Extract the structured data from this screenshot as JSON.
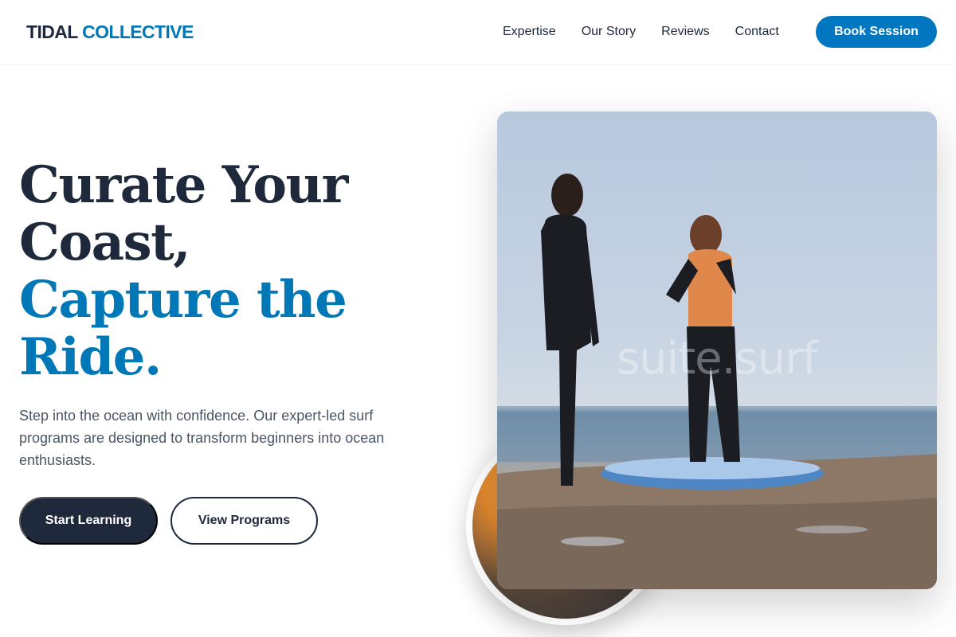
{
  "header": {
    "logo_part1": "TIDAL",
    "logo_part2": "COLLECTIVE",
    "nav": [
      "Expertise",
      "Our Story",
      "Reviews",
      "Contact"
    ],
    "cta": "Book Session"
  },
  "hero": {
    "headline_line1": "Curate Your",
    "headline_line2": "Coast,",
    "headline_line3": "Capture the",
    "headline_line4": "Ride.",
    "lead": "Step into the ocean with confidence. Our expert-led surf programs are designed to transform beginners into ocean enthusiasts.",
    "primary_button": "Start Learning",
    "secondary_button": "View Programs",
    "image_watermark": "suite.surf"
  },
  "colors": {
    "brand_blue": "#0077b6",
    "dark": "#1e293b"
  }
}
